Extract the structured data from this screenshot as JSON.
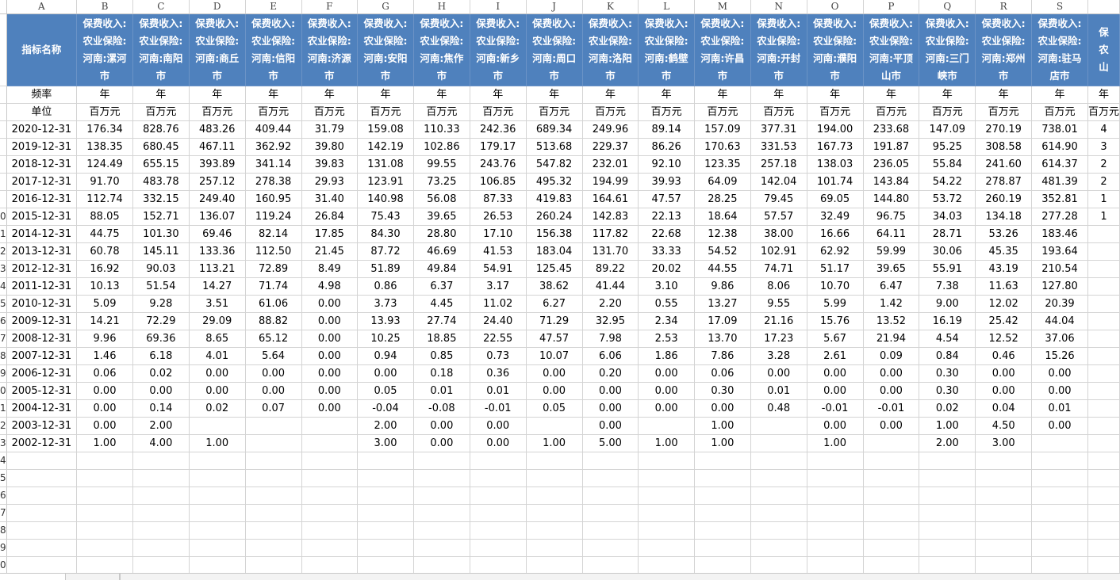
{
  "columns": [
    "A",
    "B",
    "C",
    "D",
    "E",
    "F",
    "G",
    "H",
    "I",
    "J",
    "K",
    "L",
    "M",
    "N",
    "O",
    "P",
    "Q",
    "R",
    "S"
  ],
  "header_label": "指标名称",
  "indicators": [
    [
      "保费收入:",
      "农业保险:",
      "河南:漯河",
      "市"
    ],
    [
      "保费收入:",
      "农业保险:",
      "河南:南阳",
      "市"
    ],
    [
      "保费收入:",
      "农业保险:",
      "河南:商丘",
      "市"
    ],
    [
      "保费收入:",
      "农业保险:",
      "河南:信阳",
      "市"
    ],
    [
      "保费收入:",
      "农业保险:",
      "河南:济源",
      "市"
    ],
    [
      "保费收入:",
      "农业保险:",
      "河南:安阳",
      "市"
    ],
    [
      "保费收入:",
      "农业保险:",
      "河南:焦作",
      "市"
    ],
    [
      "保费收入:",
      "农业保险:",
      "河南:新乡",
      "市"
    ],
    [
      "保费收入:",
      "农业保险:",
      "河南:周口",
      "市"
    ],
    [
      "保费收入:",
      "农业保险:",
      "河南:洛阳",
      "市"
    ],
    [
      "保费收入:",
      "农业保险:",
      "河南:鹤壁",
      "市"
    ],
    [
      "保费收入:",
      "农业保险:",
      "河南:许昌",
      "市"
    ],
    [
      "保费收入:",
      "农业保险:",
      "河南:开封",
      "市"
    ],
    [
      "保费收入:",
      "农业保险:",
      "河南:濮阳",
      "市"
    ],
    [
      "保费收入:",
      "农业保险:",
      "河南:平顶",
      "山市"
    ],
    [
      "保费收入:",
      "农业保险:",
      "河南:三门",
      "峡市"
    ],
    [
      "保费收入:",
      "农业保险:",
      "河南:郑州",
      "市"
    ],
    [
      "保费收入:",
      "农业保险:",
      "河南:驻马",
      "店市"
    ],
    [
      "保",
      "农",
      "山",
      ""
    ]
  ],
  "freq_label": "频率",
  "freq_value": "年",
  "unit_label": "单位",
  "unit_value": "百万元",
  "rows": [
    [
      "2020-12-31",
      "176.34",
      "828.76",
      "483.26",
      "409.44",
      "31.79",
      "159.08",
      "110.33",
      "242.36",
      "689.34",
      "249.96",
      "89.14",
      "157.09",
      "377.31",
      "194.00",
      "233.68",
      "147.09",
      "270.19",
      "738.01",
      "4"
    ],
    [
      "2019-12-31",
      "138.35",
      "680.45",
      "467.11",
      "362.92",
      "39.80",
      "142.19",
      "102.86",
      "179.17",
      "513.68",
      "229.37",
      "86.26",
      "170.63",
      "331.53",
      "167.73",
      "191.87",
      "95.25",
      "308.58",
      "614.90",
      "3"
    ],
    [
      "2018-12-31",
      "124.49",
      "655.15",
      "393.89",
      "341.14",
      "39.83",
      "131.08",
      "99.55",
      "243.76",
      "547.82",
      "232.01",
      "92.10",
      "123.35",
      "257.18",
      "138.03",
      "236.05",
      "55.84",
      "241.60",
      "614.37",
      "2"
    ],
    [
      "2017-12-31",
      "91.70",
      "483.78",
      "257.12",
      "278.38",
      "29.93",
      "123.91",
      "73.25",
      "106.85",
      "495.32",
      "194.99",
      "39.93",
      "64.09",
      "142.04",
      "101.74",
      "143.84",
      "54.22",
      "278.87",
      "481.39",
      "2"
    ],
    [
      "2016-12-31",
      "112.74",
      "332.15",
      "249.40",
      "160.95",
      "31.40",
      "140.98",
      "56.08",
      "87.33",
      "419.83",
      "164.61",
      "47.57",
      "28.25",
      "79.45",
      "69.05",
      "144.80",
      "53.72",
      "260.19",
      "352.81",
      "1"
    ],
    [
      "2015-12-31",
      "88.05",
      "152.71",
      "136.07",
      "119.24",
      "26.84",
      "75.43",
      "39.65",
      "26.53",
      "260.24",
      "142.83",
      "22.13",
      "18.64",
      "57.57",
      "32.49",
      "96.75",
      "34.03",
      "134.18",
      "277.28",
      "1"
    ],
    [
      "2014-12-31",
      "44.75",
      "101.30",
      "69.46",
      "82.14",
      "17.85",
      "84.30",
      "28.80",
      "17.10",
      "156.38",
      "117.82",
      "22.68",
      "12.38",
      "38.00",
      "16.66",
      "64.11",
      "28.71",
      "53.26",
      "183.46",
      ""
    ],
    [
      "2013-12-31",
      "60.78",
      "145.11",
      "133.36",
      "112.50",
      "21.45",
      "87.72",
      "46.69",
      "41.53",
      "183.04",
      "131.70",
      "33.33",
      "54.52",
      "102.91",
      "62.92",
      "59.99",
      "30.06",
      "45.35",
      "193.64",
      ""
    ],
    [
      "2012-12-31",
      "16.92",
      "90.03",
      "113.21",
      "72.89",
      "8.49",
      "51.89",
      "49.84",
      "54.91",
      "125.45",
      "89.22",
      "20.02",
      "44.55",
      "74.71",
      "51.17",
      "39.65",
      "55.91",
      "43.19",
      "210.54",
      ""
    ],
    [
      "2011-12-31",
      "10.13",
      "51.54",
      "14.27",
      "71.74",
      "4.98",
      "0.86",
      "6.37",
      "3.17",
      "38.62",
      "41.44",
      "3.10",
      "9.86",
      "8.06",
      "10.70",
      "6.47",
      "7.38",
      "11.63",
      "127.80",
      ""
    ],
    [
      "2010-12-31",
      "5.09",
      "9.28",
      "3.51",
      "61.06",
      "0.00",
      "3.73",
      "4.45",
      "11.02",
      "6.27",
      "2.20",
      "0.55",
      "13.27",
      "9.55",
      "5.99",
      "1.42",
      "9.00",
      "12.02",
      "20.39",
      ""
    ],
    [
      "2009-12-31",
      "14.21",
      "72.29",
      "29.09",
      "88.82",
      "0.00",
      "13.93",
      "27.74",
      "24.40",
      "71.29",
      "32.95",
      "2.34",
      "17.09",
      "21.16",
      "15.76",
      "13.52",
      "16.19",
      "25.42",
      "44.04",
      ""
    ],
    [
      "2008-12-31",
      "9.96",
      "69.36",
      "8.65",
      "65.12",
      "0.00",
      "10.25",
      "18.85",
      "22.55",
      "47.57",
      "7.98",
      "2.53",
      "13.70",
      "17.23",
      "5.67",
      "21.94",
      "4.54",
      "12.52",
      "37.06",
      ""
    ],
    [
      "2007-12-31",
      "1.46",
      "6.18",
      "4.01",
      "5.64",
      "0.00",
      "0.94",
      "0.85",
      "0.73",
      "10.07",
      "6.06",
      "1.86",
      "7.86",
      "3.28",
      "2.61",
      "0.09",
      "0.84",
      "0.46",
      "15.26",
      ""
    ],
    [
      "2006-12-31",
      "0.06",
      "0.02",
      "0.00",
      "0.00",
      "0.00",
      "0.00",
      "0.18",
      "0.36",
      "0.00",
      "0.20",
      "0.00",
      "0.06",
      "0.00",
      "0.00",
      "0.00",
      "0.30",
      "0.00",
      "0.00",
      ""
    ],
    [
      "2005-12-31",
      "0.00",
      "0.00",
      "0.00",
      "0.00",
      "0.00",
      "0.05",
      "0.01",
      "0.01",
      "0.00",
      "0.00",
      "0.00",
      "0.30",
      "0.01",
      "0.00",
      "0.00",
      "0.30",
      "0.00",
      "0.00",
      ""
    ],
    [
      "2004-12-31",
      "0.00",
      "0.14",
      "0.02",
      "0.07",
      "0.00",
      "-0.04",
      "-0.08",
      "-0.01",
      "0.05",
      "0.00",
      "0.00",
      "0.00",
      "0.48",
      "-0.01",
      "-0.01",
      "0.02",
      "0.04",
      "0.01",
      ""
    ],
    [
      "2003-12-31",
      "0.00",
      "2.00",
      "",
      "",
      "",
      "2.00",
      "0.00",
      "0.00",
      "",
      "0.00",
      "",
      "1.00",
      "",
      "0.00",
      "0.00",
      "1.00",
      "4.50",
      "0.00",
      ""
    ],
    [
      "2002-12-31",
      "1.00",
      "4.00",
      "1.00",
      "",
      "",
      "3.00",
      "0.00",
      "0.00",
      "1.00",
      "5.00",
      "1.00",
      "1.00",
      "",
      "1.00",
      "",
      "2.00",
      "3.00",
      "",
      ""
    ]
  ],
  "row_numbers": [
    "",
    "",
    "",
    "",
    "",
    "",
    "",
    "",
    "0",
    "1",
    "2",
    "3",
    "4",
    "5",
    "6",
    "7",
    "8",
    "9",
    "0",
    "1",
    "2",
    "3",
    "4",
    "5",
    "6",
    "7",
    "8",
    "9",
    "0"
  ],
  "selected_row_number": "5"
}
